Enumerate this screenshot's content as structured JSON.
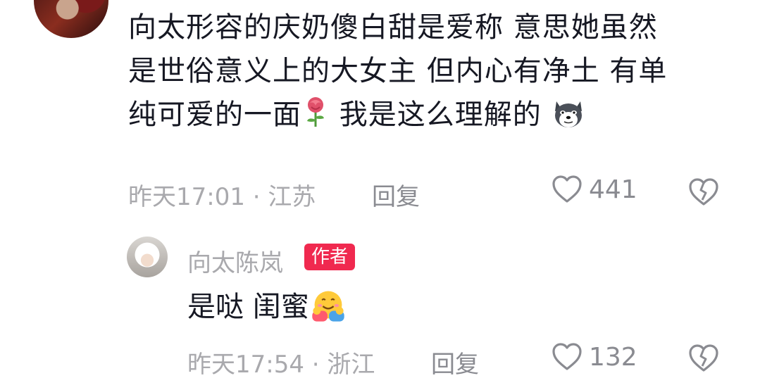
{
  "comment": {
    "line1": "向太形容的庆奶傻白甜是爱称 意思她虽然",
    "line2": "是世俗意义上的大女主 但内心有净土 有单",
    "line3_part1": "纯可爱的一面",
    "line3_part2": " 我是这么理解的 ",
    "emoji1": "rose-emoji",
    "emoji2": "husky-dog-emoji",
    "meta": "昨天17:01 · 江苏",
    "reply_label": "回复",
    "like_count": "441"
  },
  "reply": {
    "author_name": "向太陈岚",
    "author_badge": "作者",
    "text": "是哒 闺蜜",
    "emoji": "hugging-face-emoji",
    "meta": "昨天17:54 · 浙江",
    "reply_label": "回复",
    "like_count": "132"
  },
  "colors": {
    "text": "#161823",
    "meta": "#a9a9ad",
    "action": "#8a8b91",
    "badge": "#f0294f"
  },
  "icons": [
    "heart-outline-icon",
    "broken-heart-outline-icon"
  ]
}
